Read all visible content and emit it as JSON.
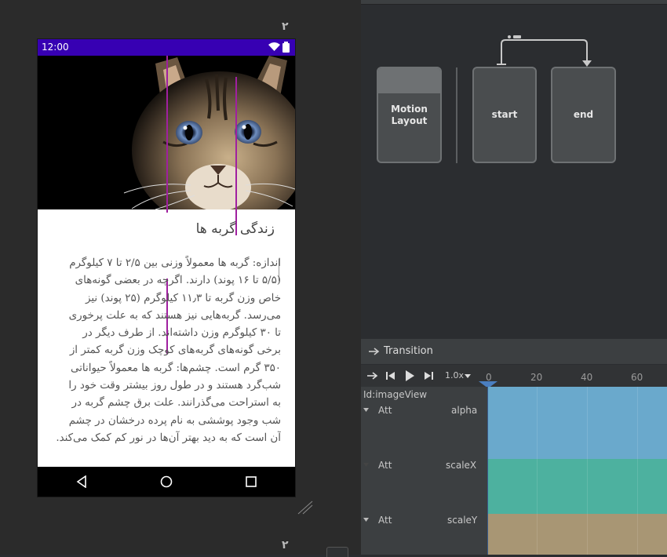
{
  "phone": {
    "status_time": "12:00",
    "title": "زندگی گربه ها",
    "body_lines": [
      "اندازه: گربه ها معمولاً وزنی بین ۲/۵ تا ۷ کیلوگرم",
      "(۵/۵ تا ۱۶ پوند) دارند. اگرچه در بعضی گونه‌های",
      "خاص وزن گربه تا ۱۱٫۳ کیلوگرم (۲۵ پوند) نیز",
      "می‌رسد. گربه‌هایی نیز هستند که به علت پرخوری",
      "تا ۳۰ کیلوگرم وزن داشته‌اند. از طرف دیگر در",
      "برخی گونه‌های گربه‌های کوچک وزن گربه کمتر از",
      "۳۵۰ گرم است. چشم‌ها: گربه ها معمولاً حیواناتی",
      "شب‌گرد هستند و در طول روز بیشتر وقت خود را",
      "به استراحت می‌گذرانند. علت برق چشم گربه در",
      "شب وجود پوششی به نام پرده درخشان در چشم",
      "آن است که به دید بهتر آن‌ها در نور کم کمک می‌کند."
    ]
  },
  "canvas": {
    "label_top": "۲",
    "label_bottom": "۲"
  },
  "graph": {
    "motion_layout_label": "Motion\nLayout",
    "start_label": "start",
    "end_label": "end"
  },
  "timeline": {
    "title": "Transition",
    "speed": "1.0x",
    "ruler": [
      "0",
      "20",
      "40",
      "60"
    ],
    "view_id": "Id:imageView",
    "rows": [
      {
        "att": "Att",
        "name": "alpha",
        "color": "#6aa9cc"
      },
      {
        "att": "Att",
        "name": "scaleX",
        "color": "#4db19f"
      },
      {
        "att": "Att",
        "name": "scaleY",
        "color": "#a89674"
      }
    ]
  },
  "colors": {
    "status_bar": "#3700b3",
    "guide_line": "#a020a0"
  }
}
